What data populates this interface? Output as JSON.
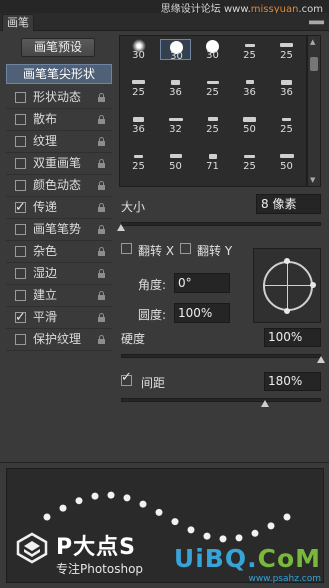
{
  "header": {
    "watermark_cn": "思缘设计论坛",
    "watermark_url_prefix": "www.",
    "watermark_url_mid": "missyuan",
    "watermark_url_suffix": ".com"
  },
  "panel": {
    "tab_label": "画笔",
    "menu_icon": "panel-menu-icon",
    "preset_button": "画笔预设"
  },
  "left_list": [
    {
      "label": "画笔笔尖形状",
      "selected": true,
      "has_checkbox": false
    },
    {
      "label": "形状动态",
      "checked": false
    },
    {
      "label": "散布",
      "checked": false
    },
    {
      "label": "纹理",
      "checked": false
    },
    {
      "label": "双重画笔",
      "checked": false
    },
    {
      "label": "颜色动态",
      "checked": false
    },
    {
      "label": "传递",
      "checked": true
    },
    {
      "label": "画笔笔势",
      "checked": false
    },
    {
      "label": "杂色",
      "checked": false
    },
    {
      "label": "湿边",
      "checked": false
    },
    {
      "label": "建立",
      "checked": false
    },
    {
      "label": "平滑",
      "checked": true
    },
    {
      "label": "保护纹理",
      "checked": false
    }
  ],
  "brush_tips": {
    "row0": [
      "30",
      "30",
      "30",
      "25",
      "25"
    ],
    "row1": [
      "25",
      "36",
      "25",
      "36",
      "36"
    ],
    "row2": [
      "36",
      "32",
      "25",
      "50",
      "25"
    ],
    "row3": [
      "25",
      "50",
      "71",
      "25",
      "50"
    ],
    "selected_index": 1
  },
  "size": {
    "label": "大小",
    "value": "8 像素",
    "fraction": 0.0
  },
  "flip_x": {
    "label": "翻转 X",
    "checked": false
  },
  "flip_y": {
    "label": "翻转 Y",
    "checked": false
  },
  "angle": {
    "label": "角度:",
    "value": "0°"
  },
  "roundness": {
    "label": "圆度:",
    "value": "100%"
  },
  "hardness": {
    "label": "硬度",
    "value": "100%",
    "fraction": 1.0
  },
  "spacing": {
    "label": "间距",
    "value": "180%",
    "checked": true,
    "fraction": 0.72
  },
  "branding": {
    "name": "P大点S",
    "tagline": "专注Photoshop",
    "site_u": "UiBQ",
    "site_dot": ".",
    "site_com": "CoM",
    "site_small": "www.psahz.com"
  },
  "colors": {
    "panel_bg": "#3a3a3a",
    "selected_bg": "#4f6077",
    "accent_blue": "#37a3d6",
    "accent_green": "#78b83a"
  }
}
